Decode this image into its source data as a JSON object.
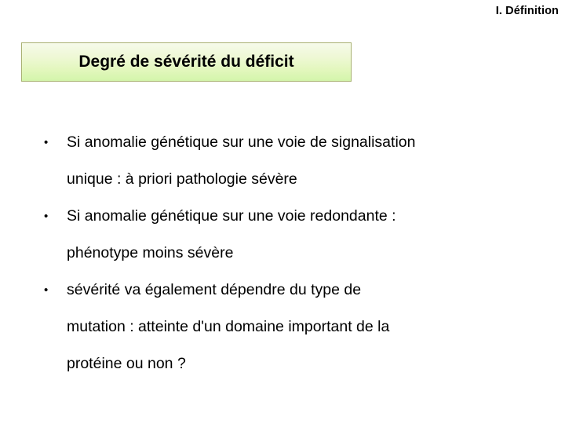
{
  "header": {
    "section_label": "I. Définition"
  },
  "title_banner": {
    "text": "Degré de sévérité du déficit",
    "border_color": "#a9b173",
    "gradient_top_color": "#f6faea",
    "gradient_bottom_color": "#d3f5ab"
  },
  "body": {
    "bullet_marker": "•",
    "bullets": [
      {
        "lines": [
          "Si anomalie génétique sur une voie de signalisation",
          "unique : à priori pathologie sévère"
        ]
      },
      {
        "lines": [
          "Si anomalie génétique sur une voie redondante :",
          "phénotype moins sévère"
        ]
      },
      {
        "lines": [
          "sévérité va également dépendre du type de",
          "mutation : atteinte d'un domaine important de la",
          "protéine ou non ?"
        ]
      }
    ]
  },
  "page": {
    "background_color": "#ffffff",
    "text_color": "#000000"
  }
}
